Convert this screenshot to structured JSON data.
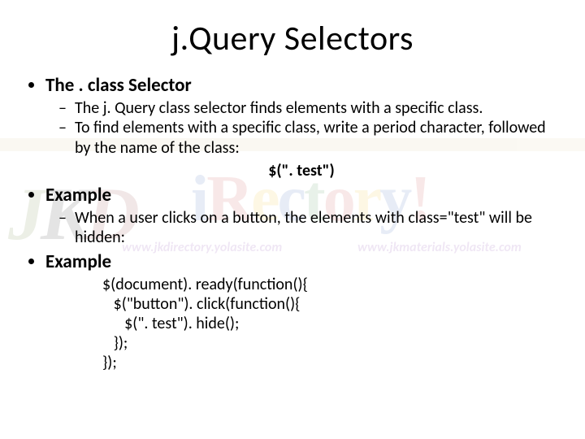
{
  "title": "j.Query Selectors",
  "bullets": {
    "b1_label": "The . class Selector",
    "b1_sub1": "The j. Query class selector finds elements with a specific class.",
    "b1_sub2": "To find elements with a specific class, write a period character, followed by the name of the class:",
    "b1_code": "$(\". test\")",
    "b2_label": "Example",
    "b2_sub1": "When a user clicks on a button, the elements with class=\"test\" will be hidden:",
    "b3_label": "Example",
    "code_l1": "$(document). ready(function(){",
    "code_l2": "   $(\"button\"). click(function(){",
    "code_l3": "      $(\". test\"). hide();",
    "code_l4": "   });",
    "code_l5": "});"
  },
  "watermark": {
    "url1": "www.jkdirectory.yolasite.com",
    "url2": "www.jkmaterials.yolasite.com"
  }
}
